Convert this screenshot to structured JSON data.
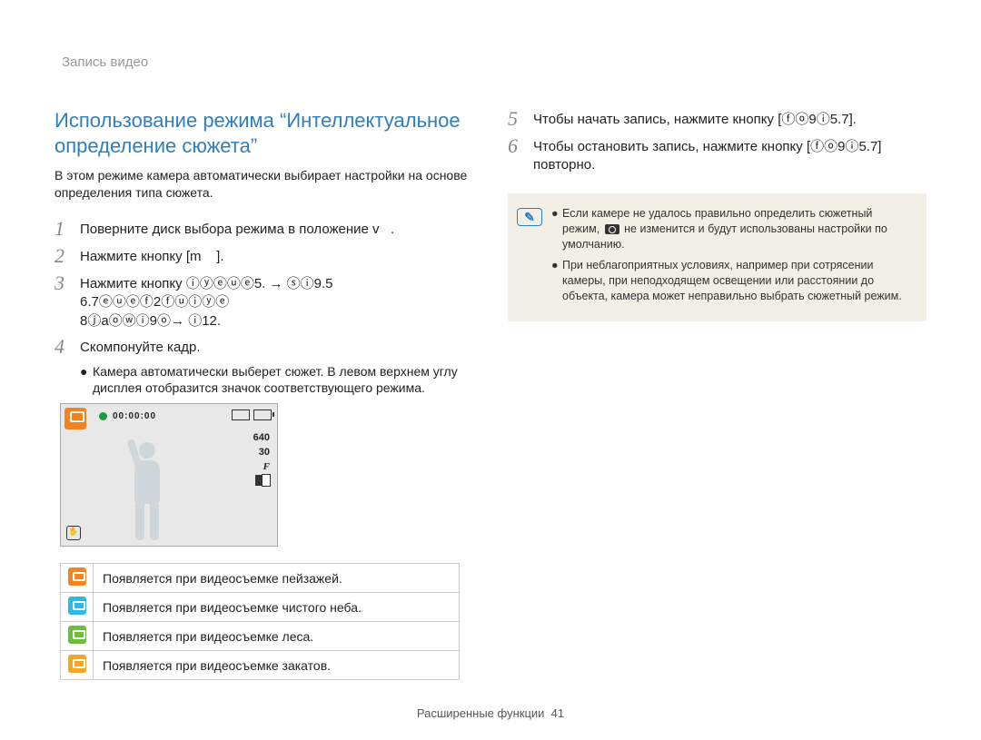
{
  "breadcrumb": "Запись видео",
  "heading": "Использование режима “Интеллектуальное определение сюжета”",
  "intro": "В этом режиме камера автоматически выбирает настройки на основе определения типа сюжета.",
  "steps_left": [
    {
      "num": "1",
      "text": "Поверните диск выбора режима в положение v   ."
    },
    {
      "num": "2",
      "text": "Нажмите кнопку [m    ]."
    },
    {
      "num": "3",
      "text": "Нажмите кнопку  ⓘⓨⓔⓤⓔ5. → ⓢⓘ9.5 6.7ⓔⓤⓔⓕ2ⓕⓤⓘⓨⓔ",
      "cont": "8ⓙaⓞⓦⓘ9ⓞ→ ⓘ12."
    },
    {
      "num": "4",
      "text": "Скомпонуйте кадр."
    }
  ],
  "sub_bullet": "Камера автоматически выберет сюжет. В левом верхнем углу дисплея отобразится значок соответствующего режима.",
  "camera_display": {
    "rec_time": "00:00:00",
    "res": "640",
    "fps": "30",
    "f_symbol": "F"
  },
  "legend": [
    {
      "color": "orange",
      "text": "Появляется при видеосъемке пейзажей."
    },
    {
      "color": "cyan",
      "text": "Появляется при видеосъемке чистого неба."
    },
    {
      "color": "green",
      "text": "Появляется при видеосъемке леса."
    },
    {
      "color": "amber",
      "text": "Появляется при видеосъемке закатов."
    }
  ],
  "steps_right": [
    {
      "num": "5",
      "text": "Чтобы начать запись, нажмите кнопку [ⓕⓞ9ⓘ5.7]."
    },
    {
      "num": "6",
      "text": "Чтобы остановить запись, нажмите кнопку [ⓕⓞ9ⓘ5.7] повторно."
    }
  ],
  "info": {
    "glyph": "✉",
    "bullets": [
      {
        "pre": "Если камере не удалось правильно определить сюжетный режим, ",
        "icon": true,
        "post": " не изменится и будут использованы настройки по умолчанию."
      },
      {
        "pre": "При неблагоприятных условиях, например при сотрясении камеры, при неподходящем освещении или расстоянии до объекта, камера может неправильно выбрать сюжетный режим.",
        "icon": false,
        "post": ""
      }
    ]
  },
  "footer": {
    "label": "Расширенные функции",
    "page": "41"
  }
}
